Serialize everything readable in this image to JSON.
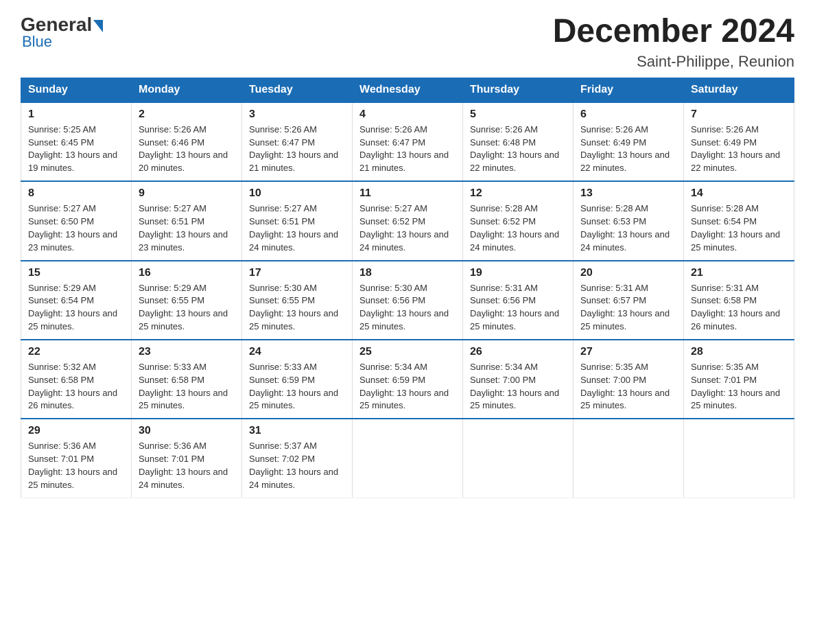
{
  "logo": {
    "general": "General",
    "blue": "Blue"
  },
  "title": "December 2024",
  "subtitle": "Saint-Philippe, Reunion",
  "headers": [
    "Sunday",
    "Monday",
    "Tuesday",
    "Wednesday",
    "Thursday",
    "Friday",
    "Saturday"
  ],
  "weeks": [
    [
      {
        "day": "1",
        "sunrise": "5:25 AM",
        "sunset": "6:45 PM",
        "daylight": "13 hours and 19 minutes."
      },
      {
        "day": "2",
        "sunrise": "5:26 AM",
        "sunset": "6:46 PM",
        "daylight": "13 hours and 20 minutes."
      },
      {
        "day": "3",
        "sunrise": "5:26 AM",
        "sunset": "6:47 PM",
        "daylight": "13 hours and 21 minutes."
      },
      {
        "day": "4",
        "sunrise": "5:26 AM",
        "sunset": "6:47 PM",
        "daylight": "13 hours and 21 minutes."
      },
      {
        "day": "5",
        "sunrise": "5:26 AM",
        "sunset": "6:48 PM",
        "daylight": "13 hours and 22 minutes."
      },
      {
        "day": "6",
        "sunrise": "5:26 AM",
        "sunset": "6:49 PM",
        "daylight": "13 hours and 22 minutes."
      },
      {
        "day": "7",
        "sunrise": "5:26 AM",
        "sunset": "6:49 PM",
        "daylight": "13 hours and 22 minutes."
      }
    ],
    [
      {
        "day": "8",
        "sunrise": "5:27 AM",
        "sunset": "6:50 PM",
        "daylight": "13 hours and 23 minutes."
      },
      {
        "day": "9",
        "sunrise": "5:27 AM",
        "sunset": "6:51 PM",
        "daylight": "13 hours and 23 minutes."
      },
      {
        "day": "10",
        "sunrise": "5:27 AM",
        "sunset": "6:51 PM",
        "daylight": "13 hours and 24 minutes."
      },
      {
        "day": "11",
        "sunrise": "5:27 AM",
        "sunset": "6:52 PM",
        "daylight": "13 hours and 24 minutes."
      },
      {
        "day": "12",
        "sunrise": "5:28 AM",
        "sunset": "6:52 PM",
        "daylight": "13 hours and 24 minutes."
      },
      {
        "day": "13",
        "sunrise": "5:28 AM",
        "sunset": "6:53 PM",
        "daylight": "13 hours and 24 minutes."
      },
      {
        "day": "14",
        "sunrise": "5:28 AM",
        "sunset": "6:54 PM",
        "daylight": "13 hours and 25 minutes."
      }
    ],
    [
      {
        "day": "15",
        "sunrise": "5:29 AM",
        "sunset": "6:54 PM",
        "daylight": "13 hours and 25 minutes."
      },
      {
        "day": "16",
        "sunrise": "5:29 AM",
        "sunset": "6:55 PM",
        "daylight": "13 hours and 25 minutes."
      },
      {
        "day": "17",
        "sunrise": "5:30 AM",
        "sunset": "6:55 PM",
        "daylight": "13 hours and 25 minutes."
      },
      {
        "day": "18",
        "sunrise": "5:30 AM",
        "sunset": "6:56 PM",
        "daylight": "13 hours and 25 minutes."
      },
      {
        "day": "19",
        "sunrise": "5:31 AM",
        "sunset": "6:56 PM",
        "daylight": "13 hours and 25 minutes."
      },
      {
        "day": "20",
        "sunrise": "5:31 AM",
        "sunset": "6:57 PM",
        "daylight": "13 hours and 25 minutes."
      },
      {
        "day": "21",
        "sunrise": "5:31 AM",
        "sunset": "6:58 PM",
        "daylight": "13 hours and 26 minutes."
      }
    ],
    [
      {
        "day": "22",
        "sunrise": "5:32 AM",
        "sunset": "6:58 PM",
        "daylight": "13 hours and 26 minutes."
      },
      {
        "day": "23",
        "sunrise": "5:33 AM",
        "sunset": "6:58 PM",
        "daylight": "13 hours and 25 minutes."
      },
      {
        "day": "24",
        "sunrise": "5:33 AM",
        "sunset": "6:59 PM",
        "daylight": "13 hours and 25 minutes."
      },
      {
        "day": "25",
        "sunrise": "5:34 AM",
        "sunset": "6:59 PM",
        "daylight": "13 hours and 25 minutes."
      },
      {
        "day": "26",
        "sunrise": "5:34 AM",
        "sunset": "7:00 PM",
        "daylight": "13 hours and 25 minutes."
      },
      {
        "day": "27",
        "sunrise": "5:35 AM",
        "sunset": "7:00 PM",
        "daylight": "13 hours and 25 minutes."
      },
      {
        "day": "28",
        "sunrise": "5:35 AM",
        "sunset": "7:01 PM",
        "daylight": "13 hours and 25 minutes."
      }
    ],
    [
      {
        "day": "29",
        "sunrise": "5:36 AM",
        "sunset": "7:01 PM",
        "daylight": "13 hours and 25 minutes."
      },
      {
        "day": "30",
        "sunrise": "5:36 AM",
        "sunset": "7:01 PM",
        "daylight": "13 hours and 24 minutes."
      },
      {
        "day": "31",
        "sunrise": "5:37 AM",
        "sunset": "7:02 PM",
        "daylight": "13 hours and 24 minutes."
      },
      null,
      null,
      null,
      null
    ]
  ]
}
